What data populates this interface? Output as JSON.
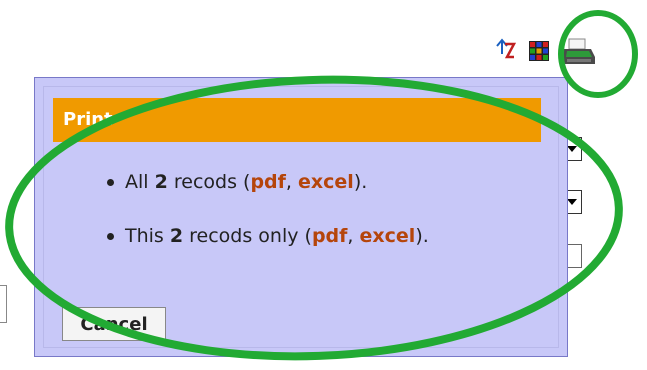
{
  "toolbar": {
    "icons": [
      "sort-icon",
      "grid-icon",
      "printer-icon"
    ]
  },
  "popup": {
    "title": "Print",
    "items": [
      {
        "prefix": "All ",
        "count": "2",
        "middle": " recods (",
        "pdf": "pdf",
        "sep": ", ",
        "excel": "excel",
        "suffix": ")."
      },
      {
        "prefix": "This ",
        "count": "2",
        "middle": " recods only (",
        "pdf": "pdf",
        "sep": ", ",
        "excel": "excel",
        "suffix": ")."
      }
    ],
    "cancel_label": "Cancel"
  },
  "colors": {
    "title_bg": "#f09a00",
    "popup_bg": "#c8c8f8",
    "link": "#b5450b",
    "annotation": "#22aa33"
  }
}
